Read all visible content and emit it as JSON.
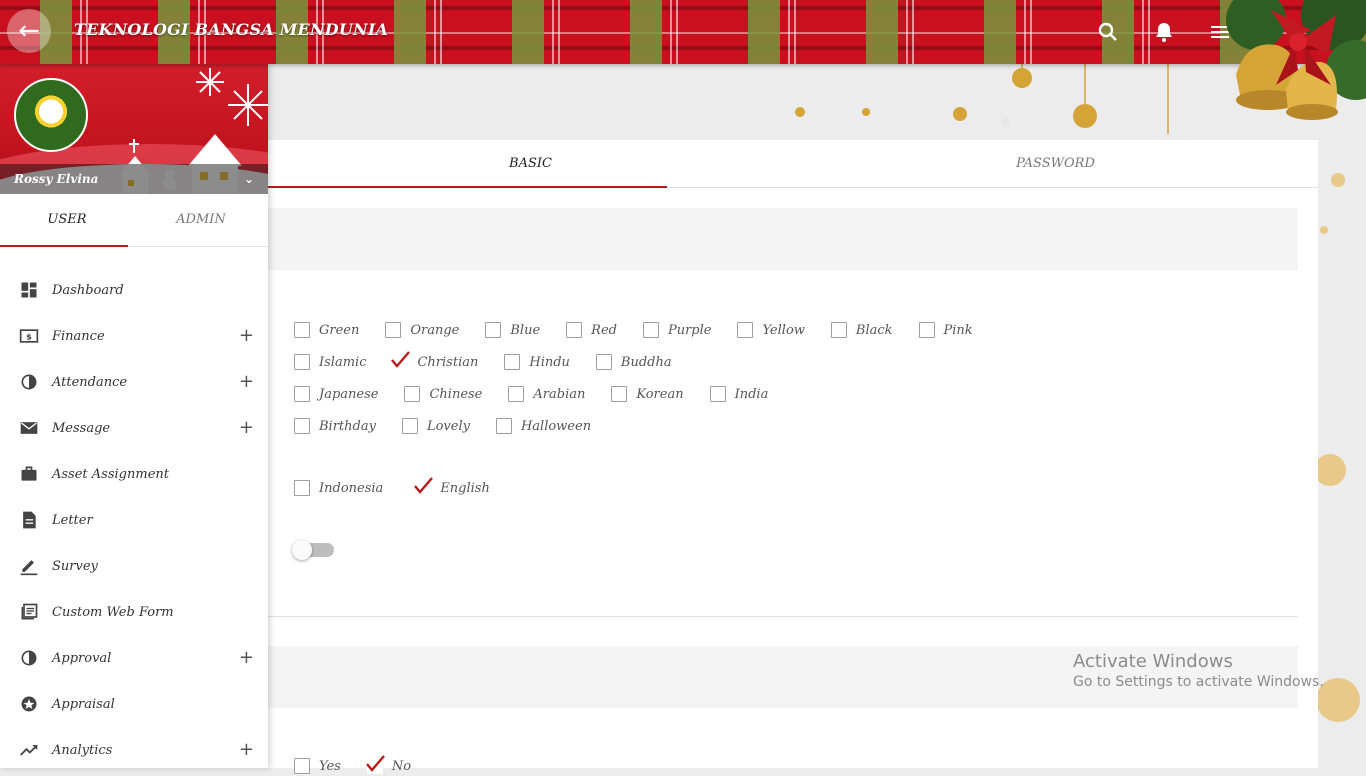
{
  "header": {
    "title": "TEKNOLOGI BANGSA MENDUNIA",
    "back_icon": "arrow-left-icon",
    "icons": [
      "search-icon",
      "bell-icon",
      "list-icon",
      "more-vert-icon",
      "chat-icon"
    ]
  },
  "sidebar": {
    "username": "Rossy Elvina",
    "tabs": [
      {
        "label": "USER",
        "active": true
      },
      {
        "label": "ADMIN",
        "active": false
      }
    ],
    "items": [
      {
        "label": "Dashboard",
        "icon": "dashboard-icon",
        "expandable": false
      },
      {
        "label": "Finance",
        "icon": "finance-icon",
        "expandable": true
      },
      {
        "label": "Attendance",
        "icon": "attendance-icon",
        "expandable": true
      },
      {
        "label": "Message",
        "icon": "mail-icon",
        "expandable": true
      },
      {
        "label": "Asset Assignment",
        "icon": "briefcase-icon",
        "expandable": false
      },
      {
        "label": "Letter",
        "icon": "document-icon",
        "expandable": false
      },
      {
        "label": "Survey",
        "icon": "pencil-icon",
        "expandable": false
      },
      {
        "label": "Custom Web Form",
        "icon": "form-icon",
        "expandable": false
      },
      {
        "label": "Approval",
        "icon": "approval-icon",
        "expandable": true
      },
      {
        "label": "Appraisal",
        "icon": "star-icon",
        "expandable": false
      },
      {
        "label": "Analytics",
        "icon": "trending-icon",
        "expandable": true
      }
    ],
    "plus_symbol": "+"
  },
  "main": {
    "tabs": [
      {
        "label": "BASIC",
        "active": true
      },
      {
        "label": "PASSWORD",
        "active": false
      }
    ],
    "theme_rows": [
      [
        {
          "label": "Green",
          "checked": false
        },
        {
          "label": "Orange",
          "checked": false
        },
        {
          "label": "Blue",
          "checked": false
        },
        {
          "label": "Red",
          "checked": false
        },
        {
          "label": "Purple",
          "checked": false
        },
        {
          "label": "Yellow",
          "checked": false
        },
        {
          "label": "Black",
          "checked": false
        },
        {
          "label": "Pink",
          "checked": false
        }
      ],
      [
        {
          "label": "Islamic",
          "checked": false
        },
        {
          "label": "Christian",
          "checked": true
        },
        {
          "label": "Hindu",
          "checked": false
        },
        {
          "label": "Buddha",
          "checked": false
        }
      ],
      [
        {
          "label": "Japanese",
          "checked": false
        },
        {
          "label": "Chinese",
          "checked": false
        },
        {
          "label": "Arabian",
          "checked": false
        },
        {
          "label": "Korean",
          "checked": false
        },
        {
          "label": "India",
          "checked": false
        }
      ],
      [
        {
          "label": "Birthday",
          "checked": false
        },
        {
          "label": "Lovely",
          "checked": false
        },
        {
          "label": "Halloween",
          "checked": false
        }
      ]
    ],
    "language_options": [
      {
        "label": "Indonesia",
        "checked": false
      },
      {
        "label": "English",
        "checked": true
      }
    ],
    "toggle_on": false,
    "yes_no_options": [
      {
        "label": "Yes",
        "checked": false
      },
      {
        "label": "No",
        "checked": true
      }
    ]
  },
  "colors": {
    "accent": "#b71c1c",
    "header_red": "#c8101e",
    "check": "#b71c1c"
  },
  "system_watermark": {
    "line1": "Activate Windows",
    "line2": "Go to Settings to activate Windows."
  }
}
